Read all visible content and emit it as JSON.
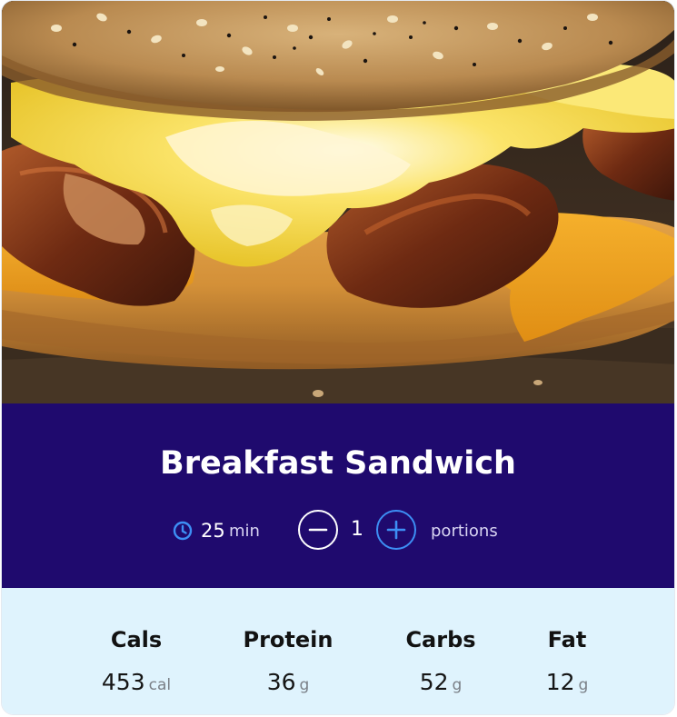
{
  "recipe": {
    "title": "Breakfast Sandwich",
    "time_value": "25",
    "time_unit": "min",
    "portion_count": "1",
    "portion_label": "portions"
  },
  "nutrition": [
    {
      "label": "Cals",
      "value": "453",
      "unit": "cal"
    },
    {
      "label": "Protein",
      "value": "36",
      "unit": "g"
    },
    {
      "label": "Carbs",
      "value": "52",
      "unit": "g"
    },
    {
      "label": "Fat",
      "value": "12",
      "unit": "g"
    }
  ],
  "colors": {
    "header_band": "#1f0a6e",
    "nutrition_bg": "#dff3fd",
    "accent": "#3d8ff5"
  },
  "icons": {
    "time": "clock-icon",
    "decrease": "minus-icon",
    "increase": "plus-icon"
  }
}
